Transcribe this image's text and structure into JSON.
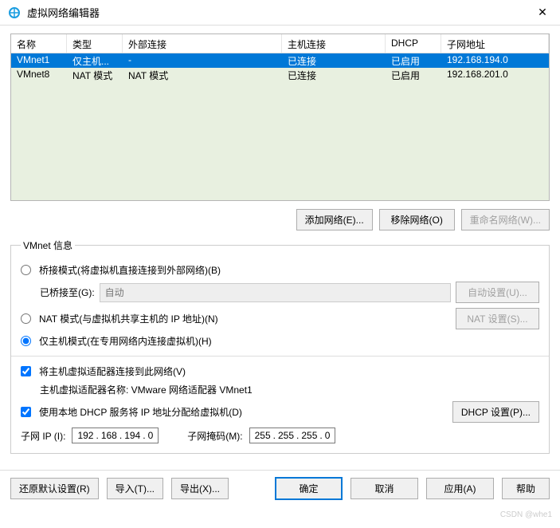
{
  "window": {
    "title": "虚拟网络编辑器"
  },
  "table": {
    "headers": [
      "名称",
      "类型",
      "外部连接",
      "主机连接",
      "DHCP",
      "子网地址"
    ],
    "rows": [
      {
        "selected": true,
        "cells": [
          "VMnet1",
          "仅主机...",
          "-",
          "已连接",
          "已启用",
          "192.168.194.0"
        ]
      },
      {
        "selected": false,
        "cells": [
          "VMnet8",
          "NAT 模式",
          "NAT 模式",
          "已连接",
          "已启用",
          "192.168.201.0"
        ]
      }
    ]
  },
  "net_buttons": {
    "add": "添加网络(E)...",
    "remove": "移除网络(O)",
    "rename": "重命名网络(W)..."
  },
  "info": {
    "legend": "VMnet 信息",
    "bridge_radio": "桥接模式(将虚拟机直接连接到外部网络)(B)",
    "bridge_to_label": "已桥接至(G):",
    "bridge_select": "自动",
    "auto_settings": "自动设置(U)...",
    "nat_radio": "NAT 模式(与虚拟机共享主机的 IP 地址)(N)",
    "nat_settings": "NAT 设置(S)...",
    "host_radio": "仅主机模式(在专用网络内连接虚拟机)(H)",
    "connect_check": "将主机虚拟适配器连接到此网络(V)",
    "adapter_label": "主机虚拟适配器名称: VMware 网络适配器 VMnet1",
    "dhcp_check": "使用本地 DHCP 服务将 IP 地址分配给虚拟机(D)",
    "dhcp_settings": "DHCP 设置(P)...",
    "subnet_ip_label": "子网 IP (I):",
    "subnet_ip": [
      "192",
      "168",
      "194",
      "0"
    ],
    "mask_label": "子网掩码(M):",
    "mask": [
      "255",
      "255",
      "255",
      "0"
    ]
  },
  "footer": {
    "restore": "还原默认设置(R)",
    "import": "导入(T)...",
    "export": "导出(X)...",
    "ok": "确定",
    "cancel": "取消",
    "apply": "应用(A)",
    "help": "帮助"
  },
  "watermark": "CSDN @whe1"
}
